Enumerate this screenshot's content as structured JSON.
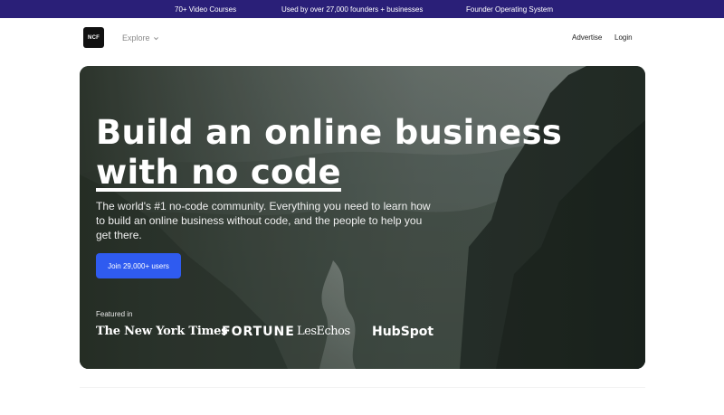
{
  "topbar": {
    "item1": "70+ Video Courses",
    "item2": "Used by over 27,000 founders + businesses",
    "item3": "Founder Operating System"
  },
  "nav": {
    "logo": "NCF",
    "explore": "Explore",
    "advertise": "Advertise",
    "login": "Login"
  },
  "hero": {
    "title_line1": "Build an online business",
    "title_line2": "with no code",
    "subtitle": "The world's #1 no-code community. Everything you need to learn how to build an online business without code, and the people to help you get there.",
    "cta": "Join 29,000+ users",
    "featured_label": "Featured in",
    "press": [
      "The New York Times",
      "FORTUNE",
      "LesEchos",
      "HubSpot"
    ]
  },
  "icons": {
    "explore_chevron": "chevron-down-icon"
  },
  "colors": {
    "topbar_bg": "#2a1f78",
    "cta_bg": "#2f5bf0"
  }
}
